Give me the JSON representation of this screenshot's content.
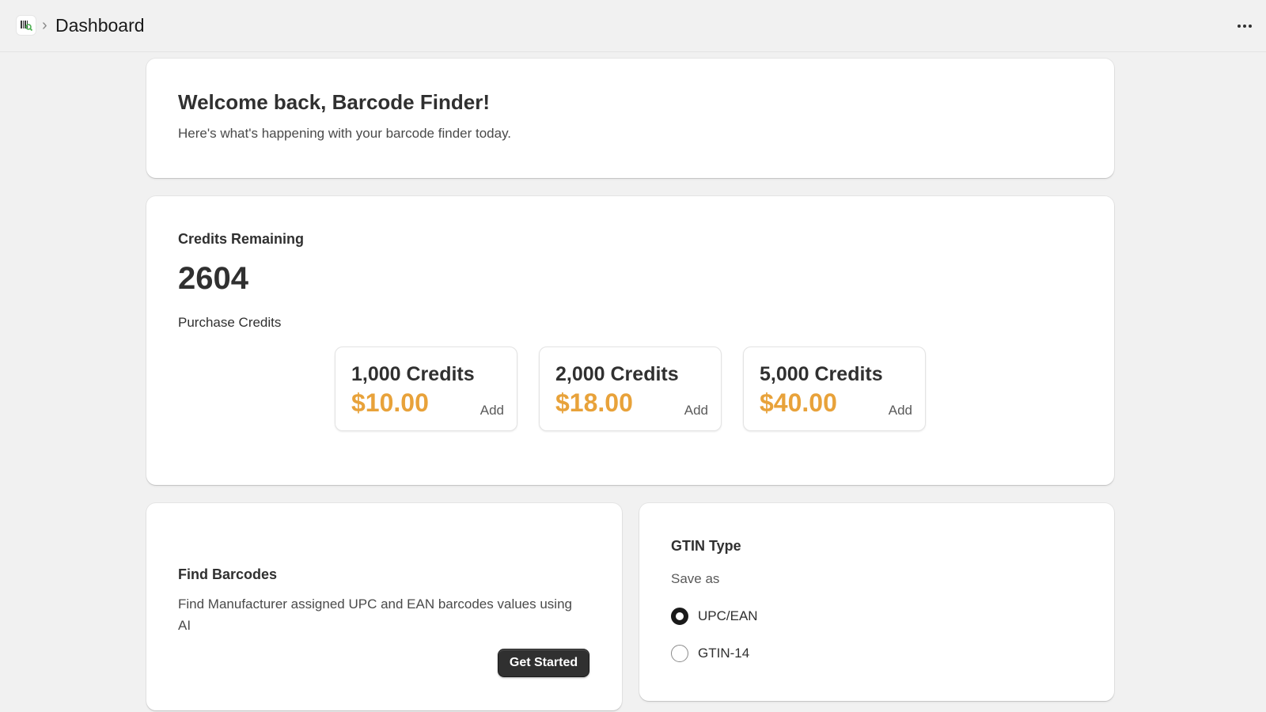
{
  "header": {
    "app_icon": "barcode-app-icon",
    "breadcrumb_separator": "›",
    "title": "Dashboard",
    "more_icon": "more-horizontal-icon"
  },
  "welcome": {
    "title": "Welcome back, Barcode Finder!",
    "subtitle": "Here's what's happening with your barcode finder today."
  },
  "credits": {
    "label": "Credits Remaining",
    "value": "2604",
    "purchase_label": "Purchase Credits",
    "packages": [
      {
        "title": "1,000 Credits",
        "price": "$10.00",
        "action": "Add"
      },
      {
        "title": "2,000 Credits",
        "price": "$18.00",
        "action": "Add"
      },
      {
        "title": "5,000 Credits",
        "price": "$40.00",
        "action": "Add"
      }
    ]
  },
  "find_barcodes": {
    "title": "Find Barcodes",
    "description": "Find Manufacturer assigned UPC and EAN barcodes values using AI",
    "button_label": "Get Started"
  },
  "gtin": {
    "title": "GTIN Type",
    "subtitle": "Save as",
    "options": [
      {
        "label": "UPC/EAN",
        "selected": true
      },
      {
        "label": "GTIN-14",
        "selected": false
      }
    ]
  },
  "colors": {
    "price_accent": "#e8a23a",
    "primary_button": "#303030",
    "background": "#f1f1f1"
  }
}
